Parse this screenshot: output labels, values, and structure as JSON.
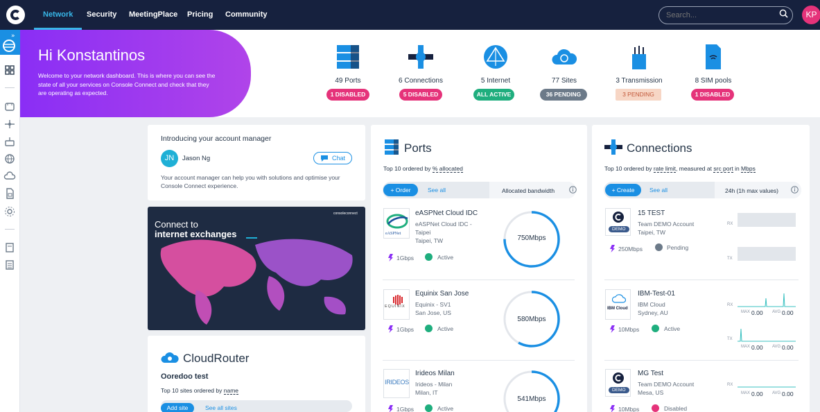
{
  "topnav": {
    "items": [
      "Network",
      "Security",
      "MeetingPlace",
      "Pricing",
      "Community"
    ],
    "search_placeholder": "Search...",
    "avatar_initials": "KP"
  },
  "hero": {
    "title": "Hi Konstantinos",
    "text": "Welcome to your network dashboard. This is where you can see the state of all your services on Console Connect and check that they are operating as expected."
  },
  "stats": [
    {
      "label": "49 Ports",
      "badge": "1 DISABLED",
      "color": "#e5337a"
    },
    {
      "label": "6 Connections",
      "badge": "5 DISABLED",
      "color": "#e5337a"
    },
    {
      "label": "5 Internet",
      "badge": "ALL ACTIVE",
      "color": "#1fae7e"
    },
    {
      "label": "77 Sites",
      "badge": "36 PENDING",
      "color": "#6c7a89"
    },
    {
      "label": "3 Transmission",
      "badge": "3 PENDING",
      "color": "#f7d6c5"
    },
    {
      "label": "8 SIM pools",
      "badge": "1 DISABLED",
      "color": "#e5337a"
    }
  ],
  "account": {
    "heading": "Introducing your account manager",
    "initials": "JN",
    "name": "Jason Ng",
    "chat": "Chat",
    "text": "Your account manager can help you with solutions and optimise your Console Connect experience."
  },
  "promo": {
    "line1": "Connect to",
    "line2": "internet exchanges",
    "brand": "consoleconnect"
  },
  "cloudrouter": {
    "title": "CloudRouter",
    "name": "Ooredoo test",
    "sub_prefix": "Top 10 sites ordered by ",
    "sub_key": "name",
    "add": "Add site",
    "see_all": "See all sites"
  },
  "ports": {
    "title": "Ports",
    "sub_prefix": "Top 10 ordered by ",
    "sub_key": "% allocated",
    "order": "+ Order",
    "see_all": "See all",
    "column": "Allocated bandwidth",
    "items": [
      {
        "title": "eASPNet Cloud IDC",
        "l1": "eASPNet Cloud IDC -",
        "l2": "Taipei",
        "l3": "Taipei, TW",
        "speed": "1Gbps",
        "status": "Active",
        "alloc": "750Mbps",
        "pct": 0.75,
        "logo": "eASPNet"
      },
      {
        "title": "Equinix San Jose",
        "l1": "Equinix - SV1",
        "l2": "San Jose, US",
        "l3": "",
        "speed": "1Gbps",
        "status": "Active",
        "alloc": "580Mbps",
        "pct": 0.58,
        "logo": "EQUINIX"
      },
      {
        "title": "Irideos Milan",
        "l1": "Irideos - Milan",
        "l2": "Milan, IT",
        "l3": "",
        "speed": "1Gbps",
        "status": "Active",
        "alloc": "541Mbps",
        "pct": 0.54,
        "logo": "IRIDEOS"
      }
    ]
  },
  "connections": {
    "title": "Connections",
    "sub_prefix": "Top 10 ordered by ",
    "sub_key": "rate limit",
    "sub_mid": ", measured at ",
    "sub_key2": "src port",
    "sub_end": " in ",
    "sub_key3": "Mbps",
    "create": "+ Create",
    "see_all": "See all",
    "column": "24h (1h max values)",
    "items": [
      {
        "title": "15 TEST",
        "l1": "Team DEMO Account",
        "l2": "Taipei, TW",
        "speed": "250Mbps",
        "status": "Pending",
        "tag": "DEMO",
        "status_color": "#6c7a89"
      },
      {
        "title": "IBM-Test-01",
        "l1": "IBM Cloud",
        "l2": "Sydney, AU",
        "speed": "10Mbps",
        "status": "Active",
        "tag": "",
        "status_color": "#1fae7e",
        "max1": "0.00",
        "avg1": "0.00",
        "max2": "0.00",
        "avg2": "0.00"
      },
      {
        "title": "MG Test",
        "l1": "Team DEMO Account",
        "l2": "Mesa, US",
        "speed": "10Mbps",
        "status": "Disabled",
        "tag": "DEMO",
        "status_color": "#e5337a",
        "max1": "0.00",
        "avg1": "0.00"
      }
    ],
    "rx": "RX",
    "tx": "TX",
    "max": "MAX",
    "avg": "AVG",
    "ibm_logo": "IBM Cloud"
  }
}
